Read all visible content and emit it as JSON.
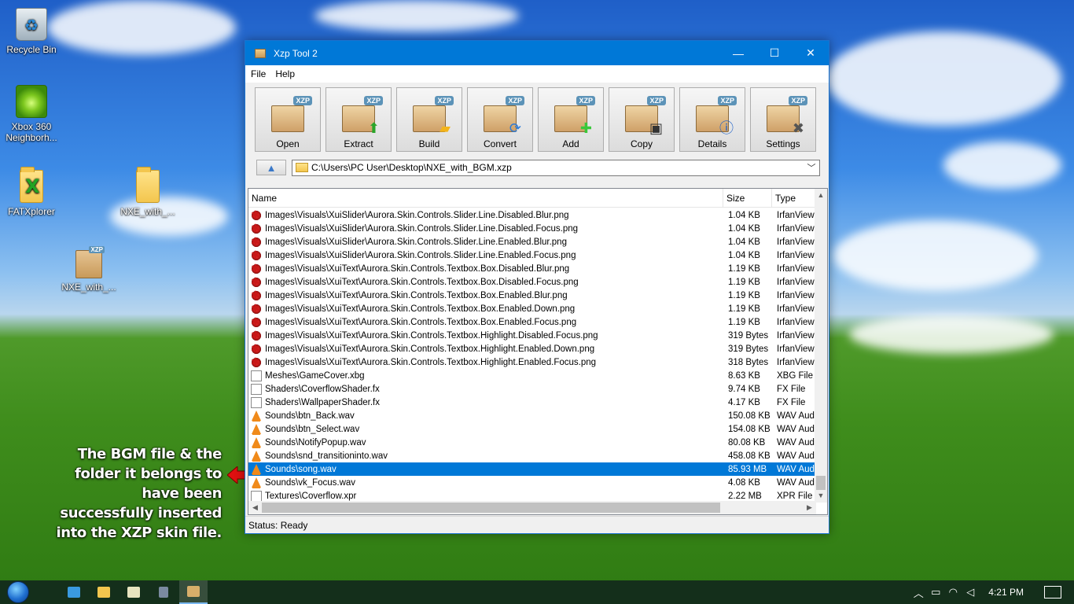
{
  "desktop": {
    "icons": [
      {
        "label": "Recycle Bin"
      },
      {
        "label": "Xbox 360 Neighborh..."
      },
      {
        "label": "FATXplorer"
      },
      {
        "label": "NXE_with_..."
      },
      {
        "label": "NXE_with_..."
      }
    ],
    "annotation": "The BGM file & the folder it belongs to have been successfully inserted into the XZP skin file."
  },
  "window": {
    "title": "Xzp Tool 2",
    "controls": {
      "minimize": "—",
      "maximize": "☐",
      "close": "✕"
    },
    "menu": [
      "File",
      "Help"
    ],
    "toolbar": [
      {
        "label": "Open",
        "icon": "open-box-icon",
        "badge": "XZP"
      },
      {
        "label": "Extract",
        "icon": "extract-box-icon",
        "badge": "XZP"
      },
      {
        "label": "Build",
        "icon": "build-box-icon",
        "badge": "XZP"
      },
      {
        "label": "Convert",
        "icon": "convert-box-icon",
        "badge": "XZP"
      },
      {
        "label": "Add",
        "icon": "add-box-icon",
        "badge": "XZP"
      },
      {
        "label": "Copy",
        "icon": "copy-box-icon",
        "badge": "XZP"
      },
      {
        "label": "Details",
        "icon": "details-box-icon",
        "badge": "XZP"
      },
      {
        "label": "Settings",
        "icon": "settings-box-icon",
        "badge": "XZP"
      }
    ],
    "path": "C:\\Users\\PC User\\Desktop\\NXE_with_BGM.xzp",
    "columns": {
      "name": "Name",
      "size": "Size",
      "type": "Type"
    },
    "rows": [
      {
        "name": "Images\\Visuals\\XuiSlider\\Aurora.Skin.Controls.Slider.Line.Disabled.Blur.png",
        "size": "1.04 KB",
        "type": "IrfanView PNG",
        "icon": "image-file-icon"
      },
      {
        "name": "Images\\Visuals\\XuiSlider\\Aurora.Skin.Controls.Slider.Line.Disabled.Focus.png",
        "size": "1.04 KB",
        "type": "IrfanView PNG",
        "icon": "image-file-icon"
      },
      {
        "name": "Images\\Visuals\\XuiSlider\\Aurora.Skin.Controls.Slider.Line.Enabled.Blur.png",
        "size": "1.04 KB",
        "type": "IrfanView PNG",
        "icon": "image-file-icon"
      },
      {
        "name": "Images\\Visuals\\XuiSlider\\Aurora.Skin.Controls.Slider.Line.Enabled.Focus.png",
        "size": "1.04 KB",
        "type": "IrfanView PNG",
        "icon": "image-file-icon"
      },
      {
        "name": "Images\\Visuals\\XuiText\\Aurora.Skin.Controls.Textbox.Box.Disabled.Blur.png",
        "size": "1.19 KB",
        "type": "IrfanView PNG",
        "icon": "image-file-icon"
      },
      {
        "name": "Images\\Visuals\\XuiText\\Aurora.Skin.Controls.Textbox.Box.Disabled.Focus.png",
        "size": "1.19 KB",
        "type": "IrfanView PNG",
        "icon": "image-file-icon"
      },
      {
        "name": "Images\\Visuals\\XuiText\\Aurora.Skin.Controls.Textbox.Box.Enabled.Blur.png",
        "size": "1.19 KB",
        "type": "IrfanView PNG",
        "icon": "image-file-icon"
      },
      {
        "name": "Images\\Visuals\\XuiText\\Aurora.Skin.Controls.Textbox.Box.Enabled.Down.png",
        "size": "1.19 KB",
        "type": "IrfanView PNG",
        "icon": "image-file-icon"
      },
      {
        "name": "Images\\Visuals\\XuiText\\Aurora.Skin.Controls.Textbox.Box.Enabled.Focus.png",
        "size": "1.19 KB",
        "type": "IrfanView PNG",
        "icon": "image-file-icon"
      },
      {
        "name": "Images\\Visuals\\XuiText\\Aurora.Skin.Controls.Textbox.Highlight.Disabled.Focus.png",
        "size": "319 Bytes",
        "type": "IrfanView PNG",
        "icon": "image-file-icon"
      },
      {
        "name": "Images\\Visuals\\XuiText\\Aurora.Skin.Controls.Textbox.Highlight.Enabled.Down.png",
        "size": "319 Bytes",
        "type": "IrfanView PNG",
        "icon": "image-file-icon"
      },
      {
        "name": "Images\\Visuals\\XuiText\\Aurora.Skin.Controls.Textbox.Highlight.Enabled.Focus.png",
        "size": "318 Bytes",
        "type": "IrfanView PNG",
        "icon": "image-file-icon"
      },
      {
        "name": "Meshes\\GameCover.xbg",
        "size": "8.63 KB",
        "type": "XBG File",
        "icon": "generic-file-icon"
      },
      {
        "name": "Shaders\\CoverflowShader.fx",
        "size": "9.74 KB",
        "type": "FX File",
        "icon": "generic-file-icon"
      },
      {
        "name": "Shaders\\WallpaperShader.fx",
        "size": "4.17 KB",
        "type": "FX File",
        "icon": "generic-file-icon"
      },
      {
        "name": "Sounds\\btn_Back.wav",
        "size": "150.08 KB",
        "type": "WAV Audio",
        "icon": "vlc-audio-icon"
      },
      {
        "name": "Sounds\\btn_Select.wav",
        "size": "154.08 KB",
        "type": "WAV Audio",
        "icon": "vlc-audio-icon"
      },
      {
        "name": "Sounds\\NotifyPopup.wav",
        "size": "80.08 KB",
        "type": "WAV Audio",
        "icon": "vlc-audio-icon"
      },
      {
        "name": "Sounds\\snd_transitioninto.wav",
        "size": "458.08 KB",
        "type": "WAV Audio",
        "icon": "vlc-audio-icon"
      },
      {
        "name": "Sounds\\song.wav",
        "size": "85.93 MB",
        "type": "WAV Audio",
        "icon": "vlc-audio-icon",
        "selected": true
      },
      {
        "name": "Sounds\\vk_Focus.wav",
        "size": "4.08 KB",
        "type": "WAV Audio",
        "icon": "vlc-audio-icon"
      },
      {
        "name": "Textures\\Coverflow.xpr",
        "size": "2.22 MB",
        "type": "XPR File",
        "icon": "generic-file-icon"
      }
    ],
    "status": "Status: Ready"
  },
  "taskbar": {
    "clock": "4:21 PM",
    "apps": [
      "start-orb",
      "xbox-app",
      "file-explorer",
      "notepad",
      "xzp-tool"
    ]
  },
  "colors": {
    "accent": "#0078d7",
    "selection": "#0078d7",
    "badge": "#5c93b8"
  }
}
